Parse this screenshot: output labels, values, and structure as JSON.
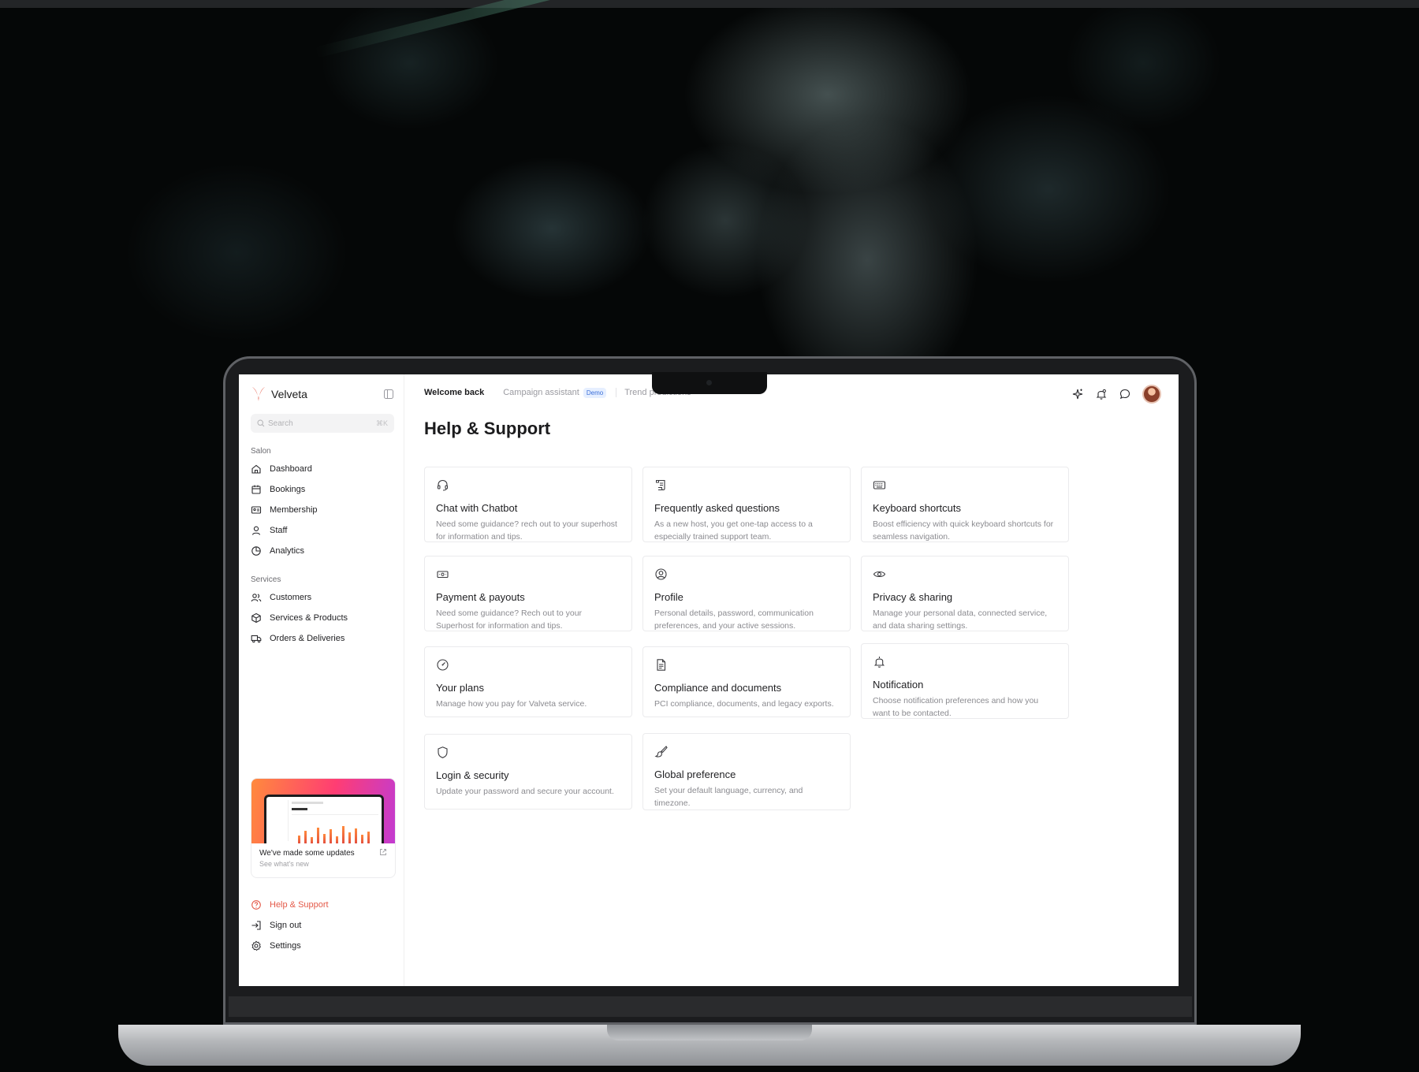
{
  "app": {
    "brand_name": "Velveta",
    "accent_color": "#e45a49"
  },
  "search": {
    "placeholder": "Search",
    "shortcut": "⌘K"
  },
  "sidebar": {
    "section_salon": "Salon",
    "salon_items": [
      {
        "label": "Dashboard",
        "icon": "home-icon"
      },
      {
        "label": "Bookings",
        "icon": "calendar-icon"
      },
      {
        "label": "Membership",
        "icon": "id-card-icon"
      },
      {
        "label": "Staff",
        "icon": "user-icon"
      },
      {
        "label": "Analytics",
        "icon": "pie-chart-icon"
      }
    ],
    "section_services": "Services",
    "services_items": [
      {
        "label": "Customers",
        "icon": "users-icon"
      },
      {
        "label": "Services & Products",
        "icon": "box-icon"
      },
      {
        "label": "Orders & Deliveries",
        "icon": "truck-icon"
      }
    ],
    "update_card": {
      "title": "We've made some updates",
      "subtitle": "See what's new"
    },
    "bottom_items": [
      {
        "label": "Help & Support",
        "icon": "help-circle-icon",
        "active": true
      },
      {
        "label": "Sign out",
        "icon": "sign-out-icon"
      },
      {
        "label": "Settings",
        "icon": "gear-icon"
      }
    ]
  },
  "header": {
    "tabs": [
      {
        "label": "Welcome back",
        "active": true
      },
      {
        "label": "Campaign assistant",
        "badge": "Demo"
      },
      {
        "label": "Trend predictions"
      }
    ],
    "actions": [
      "sparkle-icon",
      "bell-icon",
      "chat-icon",
      "avatar"
    ]
  },
  "main": {
    "title": "Help & Support",
    "cards": [
      {
        "icon": "headset-icon",
        "title": "Chat with Chatbot",
        "desc": "Need some guidance? rech out to your superhost for information and tips."
      },
      {
        "icon": "scroll-icon",
        "title": "Frequently asked questions",
        "desc": "As a new host, you get one-tap access to a especially trained support team."
      },
      {
        "icon": "keyboard-icon",
        "title": "Keyboard shortcuts",
        "desc": "Boost efficiency with quick keyboard shortcuts for seamless navigation."
      },
      {
        "icon": "money-icon",
        "title": "Payment & payouts",
        "desc": "Need some guidance? Rech out to your Superhost for information and tips."
      },
      {
        "icon": "user-circle-icon",
        "title": "Profile",
        "desc": "Personal details, password, communication preferences, and your active sessions."
      },
      {
        "icon": "eye-icon",
        "title": "Privacy & sharing",
        "desc": "Manage your personal data, connected service, and data sharing settings."
      },
      {
        "icon": "gauge-icon",
        "title": "Your plans",
        "desc": "Manage how you pay for Valveta service."
      },
      {
        "icon": "document-icon",
        "title": "Compliance and documents",
        "desc": "PCI compliance, documents, and legacy exports."
      },
      {
        "icon": "bell-icon",
        "title": "Notification",
        "desc": "Choose notification preferences and how you want to be contacted."
      },
      {
        "icon": "shield-icon",
        "title": "Login & security",
        "desc": "Update your password and secure your account."
      },
      {
        "icon": "brush-icon",
        "title": "Global preference",
        "desc": "Set your default language, currency, and timezone."
      }
    ]
  }
}
